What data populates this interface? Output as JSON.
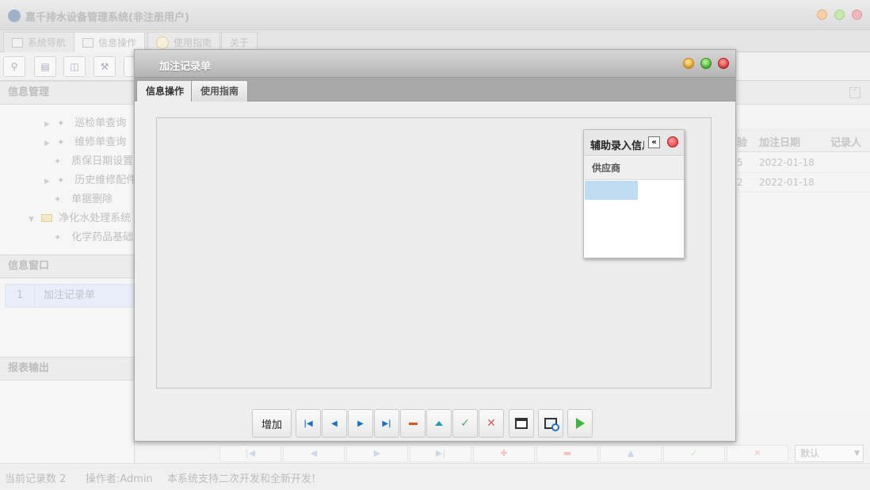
{
  "window": {
    "title": "嘉千排水设备管理系统(非注册用户)"
  },
  "main_tabs": [
    {
      "label": "系统导航"
    },
    {
      "label": "信息操作"
    },
    {
      "label": "使用指南"
    },
    {
      "label": "关于"
    }
  ],
  "sidebar": {
    "info_manage_title": "信息管理",
    "tree": [
      {
        "label": "巡检单查询",
        "expandable": true
      },
      {
        "label": "维修单查询",
        "expandable": true
      },
      {
        "label": "质保日期设置",
        "expandable": false
      },
      {
        "label": "历史维修配件",
        "expandable": true
      },
      {
        "label": "单据删除",
        "expandable": false
      },
      {
        "label": "净化水处理系统",
        "expandable": true,
        "folder": true
      },
      {
        "label": "化学药品基础",
        "expandable": false
      }
    ],
    "info_window_title": "信息窗口",
    "windows": [
      {
        "index": "1",
        "label": "加注记录单"
      }
    ],
    "report_title": "报表输出"
  },
  "grid": {
    "columns": [
      "验",
      "加注日期",
      "记录人"
    ],
    "rows": [
      {
        "c1": "5",
        "date": "2022-01-18"
      },
      {
        "c1": "2",
        "date": "2022-01-18"
      }
    ]
  },
  "combo": {
    "value": "默认"
  },
  "statusbar": {
    "record_count": "当前记录数 2",
    "operator": "操作者:Admin",
    "notice": "本系统支持二次开发和全新开发!"
  },
  "dialog": {
    "title": "加注记录单",
    "tabs": [
      {
        "label": "信息操作",
        "active": true
      },
      {
        "label": "使用指南",
        "active": false
      }
    ],
    "aux_panel": {
      "title": "辅助录入信息",
      "collapse_glyph": "«",
      "column_header": "供应商"
    },
    "buttons": {
      "add_label": "增加"
    }
  },
  "colors": {
    "dialog_title_bg": "#b5b5b5",
    "selection": "#bedcf3",
    "nav_blue": "#1c6fc7",
    "delete_orange": "#e0531b",
    "save_green": "#56a856",
    "cancel_red": "#e05a5a"
  }
}
